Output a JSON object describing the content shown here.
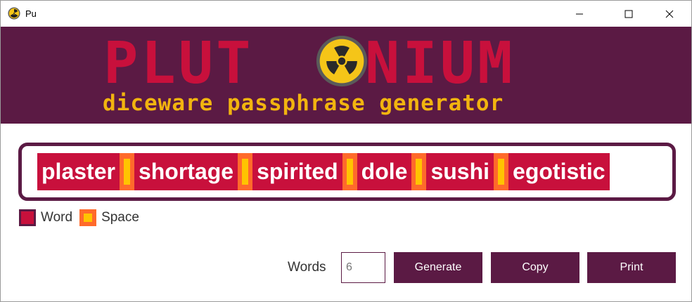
{
  "window": {
    "title": "Pu",
    "app_icon": "radiation-icon",
    "controls": [
      "minimize-icon",
      "maximize-icon",
      "close-icon"
    ]
  },
  "banner": {
    "logo_left": "PLUT",
    "logo_right": "NIUM",
    "tagline": "diceware passphrase generator",
    "logo_icon": "radiation-icon"
  },
  "passphrase": {
    "words": [
      "plaster",
      "shortage",
      "spirited",
      "dole",
      "sushi",
      "egotistic"
    ]
  },
  "legend": {
    "word_label": "Word",
    "space_label": "Space"
  },
  "controls": {
    "words_label": "Words",
    "words_placeholder": "6",
    "generate_label": "Generate",
    "copy_label": "Copy",
    "print_label": "Print"
  },
  "colors": {
    "brand": "#5b1a44",
    "word": "#c8103c",
    "space_outer": "#ff6a2b",
    "space_inner": "#ffc400",
    "tagline": "#f2b40f"
  }
}
